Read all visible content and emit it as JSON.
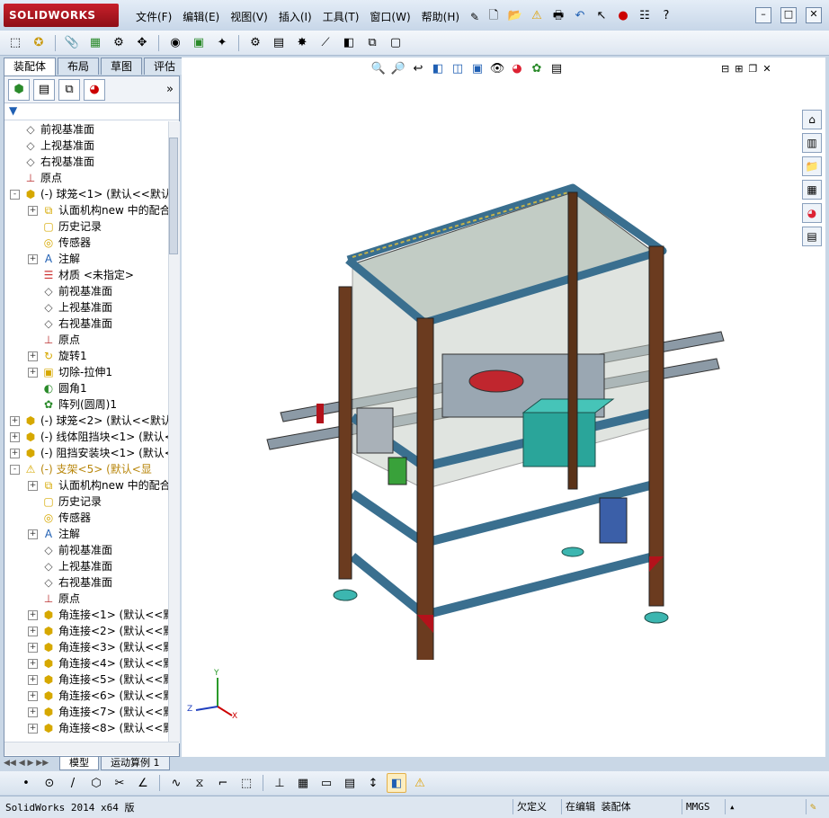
{
  "app": {
    "logo_text": "SOLIDWORKS",
    "menu": [
      "文件(F)",
      "编辑(E)",
      "视图(V)",
      "插入(I)",
      "工具(T)",
      "窗口(W)",
      "帮助(H)"
    ]
  },
  "command_manager": {
    "tabs": [
      "装配体",
      "布局",
      "草图",
      "评估"
    ],
    "active_tab": "装配体"
  },
  "feature_tree": {
    "nodes": [
      {
        "label": "前视基准面",
        "icon": "plane-icon",
        "level": 0,
        "expand": ""
      },
      {
        "label": "上视基准面",
        "icon": "plane-icon",
        "level": 0,
        "expand": ""
      },
      {
        "label": "右视基准面",
        "icon": "plane-icon",
        "level": 0,
        "expand": ""
      },
      {
        "label": "原点",
        "icon": "origin-icon",
        "level": 0,
        "expand": ""
      },
      {
        "label": "(-) 球笼<1> (默认<<默认:",
        "icon": "part-icon",
        "level": 0,
        "expand": "-"
      },
      {
        "label": "认面机构new 中的配合",
        "icon": "mates-icon",
        "level": 1,
        "expand": "+"
      },
      {
        "label": "历史记录",
        "icon": "history-icon",
        "level": 1,
        "expand": ""
      },
      {
        "label": "传感器",
        "icon": "sensor-icon",
        "level": 1,
        "expand": ""
      },
      {
        "label": "注解",
        "icon": "annotation-icon",
        "level": 1,
        "expand": "+"
      },
      {
        "label": "材质 <未指定>",
        "icon": "material-icon",
        "level": 1,
        "expand": ""
      },
      {
        "label": "前视基准面",
        "icon": "plane-icon",
        "level": 1,
        "expand": ""
      },
      {
        "label": "上视基准面",
        "icon": "plane-icon",
        "level": 1,
        "expand": ""
      },
      {
        "label": "右视基准面",
        "icon": "plane-icon",
        "level": 1,
        "expand": ""
      },
      {
        "label": "原点",
        "icon": "origin-icon",
        "level": 1,
        "expand": ""
      },
      {
        "label": "旋转1",
        "icon": "revolve-icon",
        "level": 1,
        "expand": "+"
      },
      {
        "label": "切除-拉伸1",
        "icon": "cut-extrude-icon",
        "level": 1,
        "expand": "+"
      },
      {
        "label": "圆角1",
        "icon": "fillet-icon",
        "level": 1,
        "expand": ""
      },
      {
        "label": "阵列(圆周)1",
        "icon": "pattern-icon",
        "level": 1,
        "expand": ""
      },
      {
        "label": "(-) 球笼<2> (默认<<默认:",
        "icon": "part-icon",
        "level": 0,
        "expand": "+"
      },
      {
        "label": "(-) 线体阻挡块<1> (默认<",
        "icon": "part-icon",
        "level": 0,
        "expand": "+"
      },
      {
        "label": "(-) 阻挡安装块<1> (默认<",
        "icon": "part-icon",
        "level": 0,
        "expand": "+"
      },
      {
        "label": "(-) 支架<5> (默认<显",
        "icon": "warning-part-icon",
        "level": 0,
        "expand": "-",
        "warn": true
      },
      {
        "label": "认面机构new 中的配合",
        "icon": "mates-icon",
        "level": 1,
        "expand": "+"
      },
      {
        "label": "历史记录",
        "icon": "history-icon",
        "level": 1,
        "expand": ""
      },
      {
        "label": "传感器",
        "icon": "sensor-icon",
        "level": 1,
        "expand": ""
      },
      {
        "label": "注解",
        "icon": "annotation-icon",
        "level": 1,
        "expand": "+"
      },
      {
        "label": "前视基准面",
        "icon": "plane-icon",
        "level": 1,
        "expand": ""
      },
      {
        "label": "上视基准面",
        "icon": "plane-icon",
        "level": 1,
        "expand": ""
      },
      {
        "label": "右视基准面",
        "icon": "plane-icon",
        "level": 1,
        "expand": ""
      },
      {
        "label": "原点",
        "icon": "origin-icon",
        "level": 1,
        "expand": ""
      },
      {
        "label": "角连接<1> (默认<<默认",
        "icon": "part-icon",
        "level": 1,
        "expand": "+"
      },
      {
        "label": "角连接<2> (默认<<默认",
        "icon": "part-icon",
        "level": 1,
        "expand": "+"
      },
      {
        "label": "角连接<3> (默认<<默认",
        "icon": "part-icon",
        "level": 1,
        "expand": "+"
      },
      {
        "label": "角连接<4> (默认<<默认",
        "icon": "part-icon",
        "level": 1,
        "expand": "+"
      },
      {
        "label": "角连接<5> (默认<<默认",
        "icon": "part-icon",
        "level": 1,
        "expand": "+"
      },
      {
        "label": "角连接<6> (默认<<默认",
        "icon": "part-icon",
        "level": 1,
        "expand": "+"
      },
      {
        "label": "角连接<7> (默认<<默认",
        "icon": "part-icon",
        "level": 1,
        "expand": "+"
      },
      {
        "label": "角连接<8> (默认<<默认",
        "icon": "part-icon",
        "level": 1,
        "expand": "+"
      }
    ]
  },
  "bottom_tabs": [
    "模型",
    "运动算例 1"
  ],
  "triad": {
    "x": "X",
    "y": "Y",
    "z": "Z"
  },
  "status": {
    "version": "SolidWorks 2014 x64 版",
    "definition": "欠定义",
    "editing": "在编辑 装配体",
    "units": "MMGS"
  },
  "colors": {
    "frame_profile": "#3a6f8f",
    "frame_post": "#6b3b1f",
    "accent_red": "#b3121b",
    "motor_box": "#2aa59a",
    "feet": "#3cb6b0"
  }
}
